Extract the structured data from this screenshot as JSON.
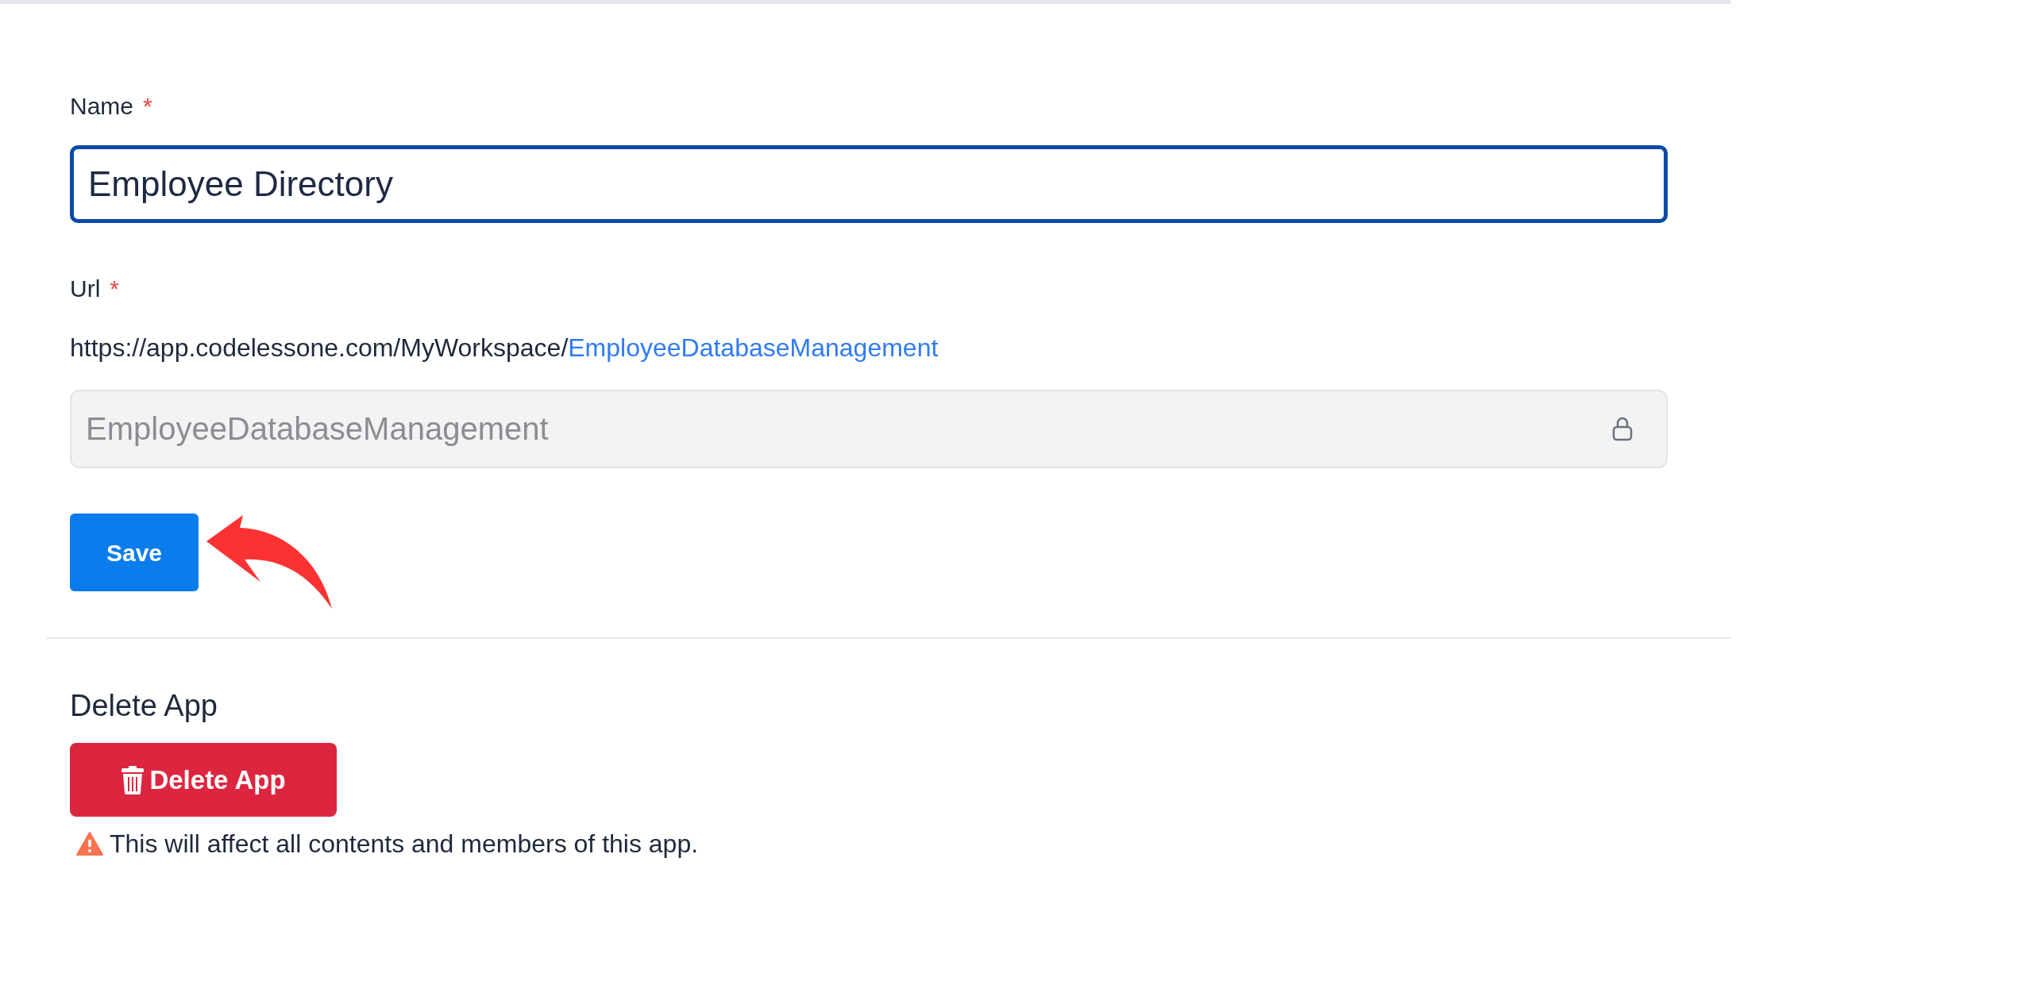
{
  "name_field": {
    "label": "Name",
    "required_mark": "*",
    "value": "Employee Directory",
    "focused": true
  },
  "url_field": {
    "label": "Url",
    "required_mark": "*",
    "preview_prefix": "https://app.codelessone.com/MyWorkspace/",
    "preview_link": "EmployeeDatabaseManagement",
    "value": "EmployeeDatabaseManagement",
    "disabled": true
  },
  "save_button": "Save",
  "annotation": {
    "kind": "arrow"
  },
  "delete_section": {
    "title": "Delete App",
    "button": "Delete App",
    "warning": "This will affect all contents and members of this app."
  }
}
